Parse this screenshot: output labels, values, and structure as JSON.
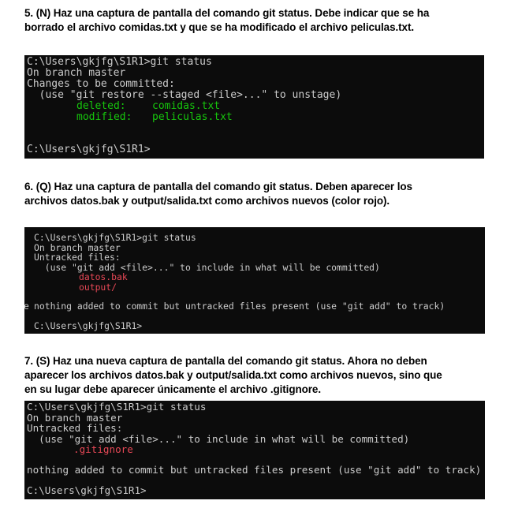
{
  "q5": {
    "line1": "5. (N) Haz una captura de pantalla del comando git status. Debe indicar que se ha",
    "line2": "borrado el archivo comidas.txt y que se ha modificado el archivo peliculas.txt."
  },
  "term1": {
    "prompt_cmd": "C:\\Users\\gkjfg\\S1R1>git status",
    "branch": "On branch master",
    "changes": "Changes to be committed:",
    "hint": "  (use \"git restore --staged <file>...\" to unstage)",
    "deleted_label": "deleted:",
    "deleted_file": "comidas.txt",
    "modified_label": "modified:",
    "modified_file": "peliculas.txt",
    "prompt_end": "C:\\Users\\gkjfg\\S1R1>"
  },
  "q6": {
    "line1": "6. (Q) Haz una captura de pantalla del comando git status. Deben aparecer los",
    "line2": "archivos datos.bak y output/salida.txt como archivos nuevos (color rojo)."
  },
  "term2": {
    "prompt_cmd": "C:\\Users\\gkjfg\\S1R1>git status",
    "branch": "On branch master",
    "untracked": "Untracked files:",
    "hint": "  (use \"git add <file>...\" to include in what will be committed)",
    "file1": "datos.bak",
    "file2": "output/",
    "edge_char": "e",
    "nothing": "nothing added to commit but untracked files present (use \"git add\" to track)",
    "prompt_end": "C:\\Users\\gkjfg\\S1R1>"
  },
  "q7": {
    "line1": "7. (S) Haz una nueva captura de pantalla del comando git status. Ahora no deben",
    "line2": "aparecer los archivos datos.bak y output/salida.txt como archivos nuevos, sino que",
    "line3": "en su lugar debe aparecer únicamente el archivo .gitignore."
  },
  "term3": {
    "prompt_cmd": "C:\\Users\\gkjfg\\S1R1>git status",
    "branch": "On branch master",
    "untracked": "Untracked files:",
    "hint": "  (use \"git add <file>...\" to include in what will be committed)",
    "file1": ".gitignore",
    "nothing": "nothing added to commit but untracked files present (use \"git add\" to track)",
    "prompt_end": "C:\\Users\\gkjfg\\S1R1>"
  },
  "colors": {
    "terminal_bg": "#0c0c0c",
    "terminal_text": "#cccccc",
    "staged_green": "#16c60c",
    "untracked_red": "#e74856"
  }
}
